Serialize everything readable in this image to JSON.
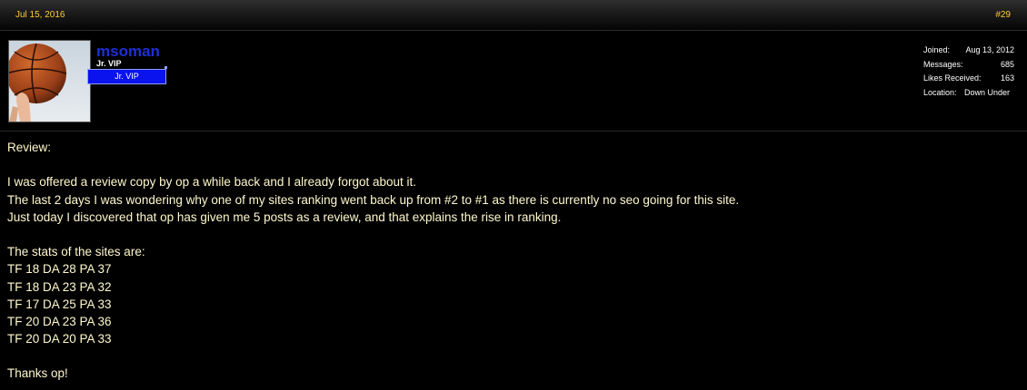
{
  "post": {
    "date": "Jul 15, 2016",
    "number": "#29"
  },
  "user": {
    "name": "msoman",
    "title": "Jr. VIP",
    "banner": "Jr. VIP",
    "avatar_icon": "basketball-avatar"
  },
  "stats": {
    "joined_label": "Joined:",
    "joined_value": "Aug 13, 2012",
    "messages_label": "Messages:",
    "messages_value": "685",
    "likes_label": "Likes Received:",
    "likes_value": "163",
    "location_label": "Location:",
    "location_value": "Down Under"
  },
  "message": {
    "lines": [
      "Review:",
      "",
      "I was offered a review copy by op a while back and I already forgot about it.",
      "The last 2 days I was wondering why one of my sites ranking went back up from #2 to #1 as there is currently no seo going for this site.",
      "Just today I discovered that op has given me 5 posts as a review, and that explains the rise in ranking.",
      "",
      "The stats of the sites are:",
      "TF 18 DA 28 PA 37",
      "TF 18 DA 23 PA 32",
      "TF 17 DA 25 PA 33",
      "TF 20 DA 23 PA 36",
      "TF 20 DA 20 PA 33",
      "",
      "Thanks op!"
    ]
  },
  "colors": {
    "date_link": "#ffcc33",
    "username": "#1f2fd6",
    "banner_bg": "#0a12ee",
    "message_text": "#fff8cc",
    "background": "#000000"
  }
}
